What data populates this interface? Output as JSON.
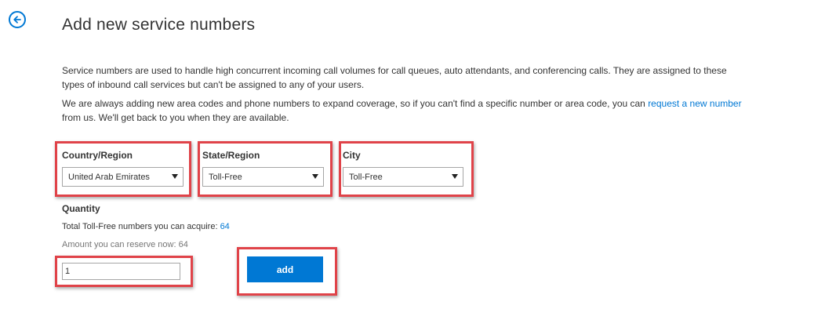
{
  "page": {
    "back_icon": "arrow-left-icon",
    "title": "Add new service numbers"
  },
  "intro": {
    "paragraph1": "Service numbers are used to handle high concurrent incoming call volumes for call queues, auto attendants, and conferencing calls. They are assigned to these types of inbound call services but can't be assigned to any of your users.",
    "paragraph2_before": "We are always adding new area codes and phone numbers to expand coverage, so if you can't find a specific number or area code, you can ",
    "paragraph2_link": "request a new number",
    "paragraph2_after": " from us. We'll get back to you when they are available."
  },
  "filters": {
    "country": {
      "label": "Country/Region",
      "value": "United Arab Emirates"
    },
    "state": {
      "label": "State/Region",
      "value": "Toll-Free"
    },
    "city": {
      "label": "City",
      "value": "Toll-Free"
    }
  },
  "quantity": {
    "label": "Quantity",
    "total_text": "Total Toll-Free numbers you can acquire: ",
    "total_value": "64",
    "reserve_text": "Amount you can reserve now: 64",
    "input_value": "1"
  },
  "actions": {
    "add_label": "add"
  },
  "colors": {
    "accent": "#0078d4",
    "highlight": "#e04349"
  }
}
